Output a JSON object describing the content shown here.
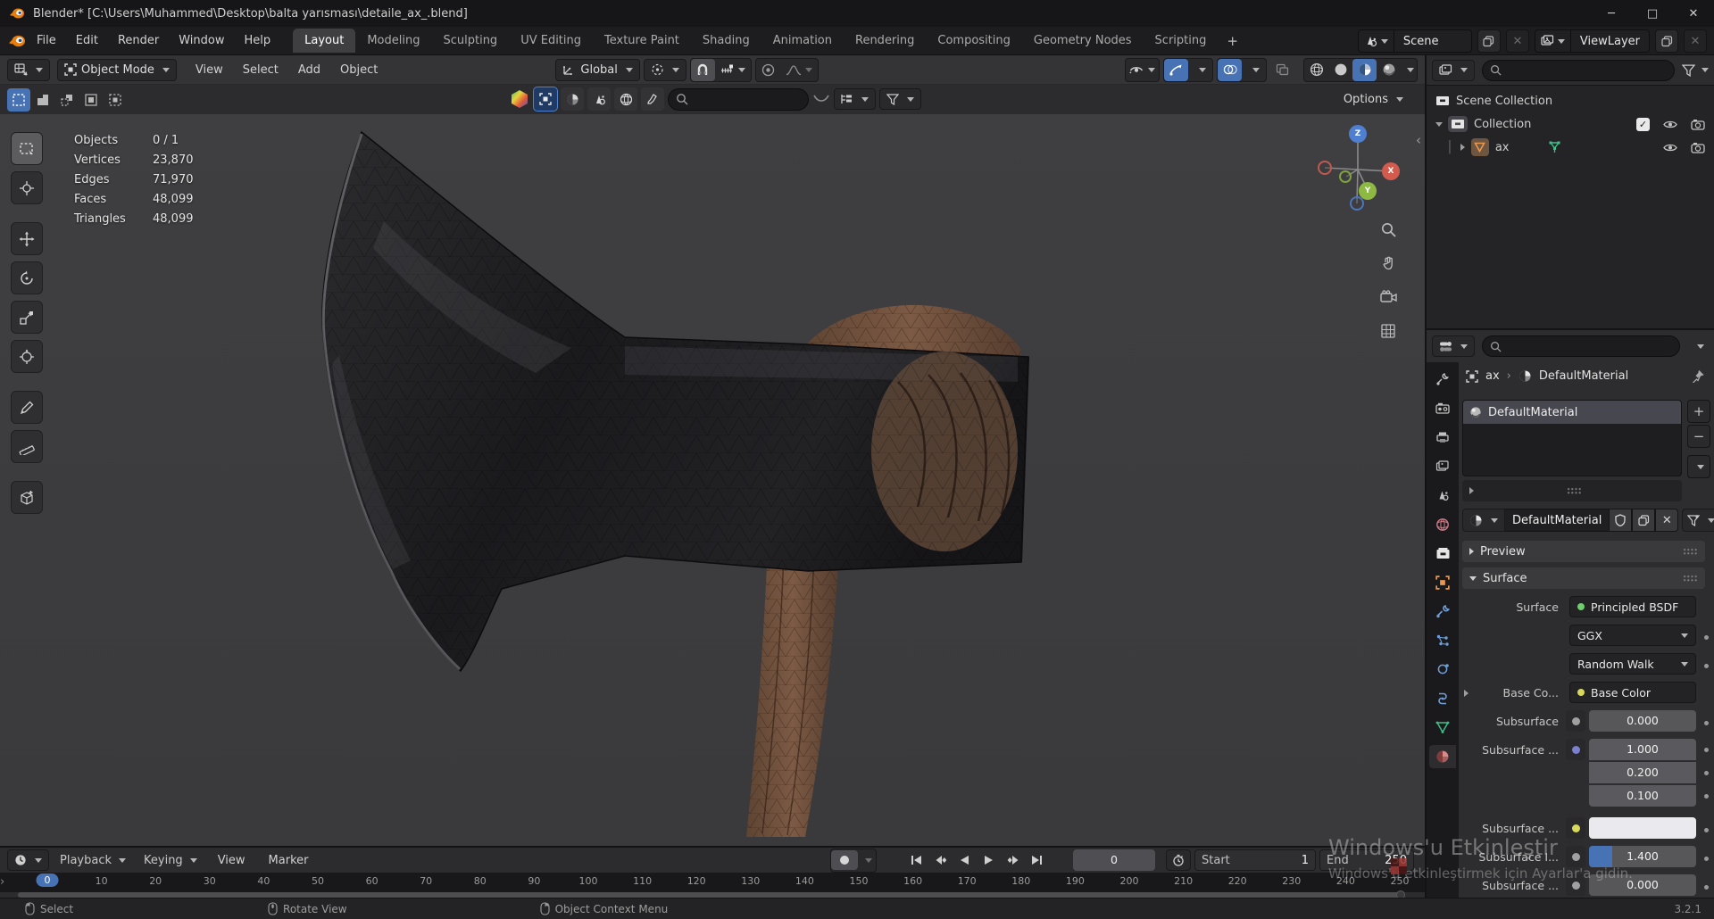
{
  "window": {
    "title": "Blender* [C:\\Users\\Muhammed\\Desktop\\balta yarısması\\detaile_ax_.blend]",
    "controls": {
      "minimize": "─",
      "maximize": "□",
      "close": "✕"
    }
  },
  "menubar": {
    "menus": [
      "File",
      "Edit",
      "Render",
      "Window",
      "Help"
    ],
    "tabs": [
      "Layout",
      "Modeling",
      "Sculpting",
      "UV Editing",
      "Texture Paint",
      "Shading",
      "Animation",
      "Rendering",
      "Compositing",
      "Geometry Nodes",
      "Scripting"
    ],
    "active_tab": "Layout",
    "add_tab": "+",
    "scene_name": "Scene",
    "view_layer_name": "ViewLayer",
    "close_glyph": "✕"
  },
  "viewport_header": {
    "mode": "Object Mode",
    "menus": [
      "View",
      "Select",
      "Add",
      "Object"
    ],
    "orientation": "Global",
    "options_label": "Options"
  },
  "stats": {
    "rows": [
      {
        "label": "Objects",
        "value": "0 / 1"
      },
      {
        "label": "Vertices",
        "value": "23,870"
      },
      {
        "label": "Edges",
        "value": "71,970"
      },
      {
        "label": "Faces",
        "value": "48,099"
      },
      {
        "label": "Triangles",
        "value": "48,099"
      }
    ]
  },
  "gizmo": {
    "x": "X",
    "y": "Y",
    "z": "Z"
  },
  "outliner": {
    "root": "Scene Collection",
    "collection": "Collection",
    "object": "ax",
    "check_glyph": "✓"
  },
  "properties": {
    "breadcrumb": {
      "object": "ax",
      "separator": "›",
      "material": "DefaultMaterial"
    },
    "slot_name": "DefaultMaterial",
    "datablock_name": "DefaultMaterial",
    "add_glyph": "+",
    "remove_glyph": "−",
    "panels": {
      "preview": "Preview",
      "surface": "Surface"
    },
    "rows": [
      {
        "label": "Surface",
        "value": "Principled BSDF"
      },
      {
        "value": "GGX"
      },
      {
        "value": "Random Walk"
      },
      {
        "label": "Base Co...",
        "value": "Base Color"
      },
      {
        "label": "Subsurface",
        "value": "0.000"
      },
      {
        "label": "Subsurface ...",
        "values": [
          "1.000",
          "0.200",
          "0.100"
        ]
      },
      {
        "label": "Subsurface ..."
      },
      {
        "label": "Subsurface I...",
        "value": "1.400"
      },
      {
        "label": "Subsurface ...",
        "value": "0.000"
      }
    ]
  },
  "timeline": {
    "menus": {
      "playback": "Playback",
      "keying": "Keying",
      "view": "View",
      "marker": "Marker"
    },
    "current_frame": "0",
    "start_label": "Start",
    "start_value": "1",
    "end_label": "End",
    "end_value": "250",
    "ticks": [
      "0",
      "10",
      "20",
      "30",
      "40",
      "50",
      "60",
      "70",
      "80",
      "90",
      "100",
      "110",
      "120",
      "130",
      "140",
      "150",
      "160",
      "170",
      "180",
      "190",
      "200",
      "210",
      "220",
      "230",
      "240",
      "250"
    ]
  },
  "statusbar": {
    "items": [
      "Select",
      "Rotate View",
      "Object Context Menu"
    ],
    "version": "3.2.1"
  },
  "watermark": {
    "line1": "Windows'u Etkinleştir",
    "line2": "Windows'u etkinleştirmek için Ayarlar'a gidin."
  },
  "colors": {
    "accent_blue": "#4772b3",
    "axis_x": "#d35b4e",
    "axis_y": "#8db842",
    "axis_z": "#4f7fd0",
    "handle_brown": "#74523f",
    "metal_dark": "#1b1b1d"
  },
  "misc": {
    "collapse_glyph": "‹",
    "expand_glyph": "›"
  }
}
